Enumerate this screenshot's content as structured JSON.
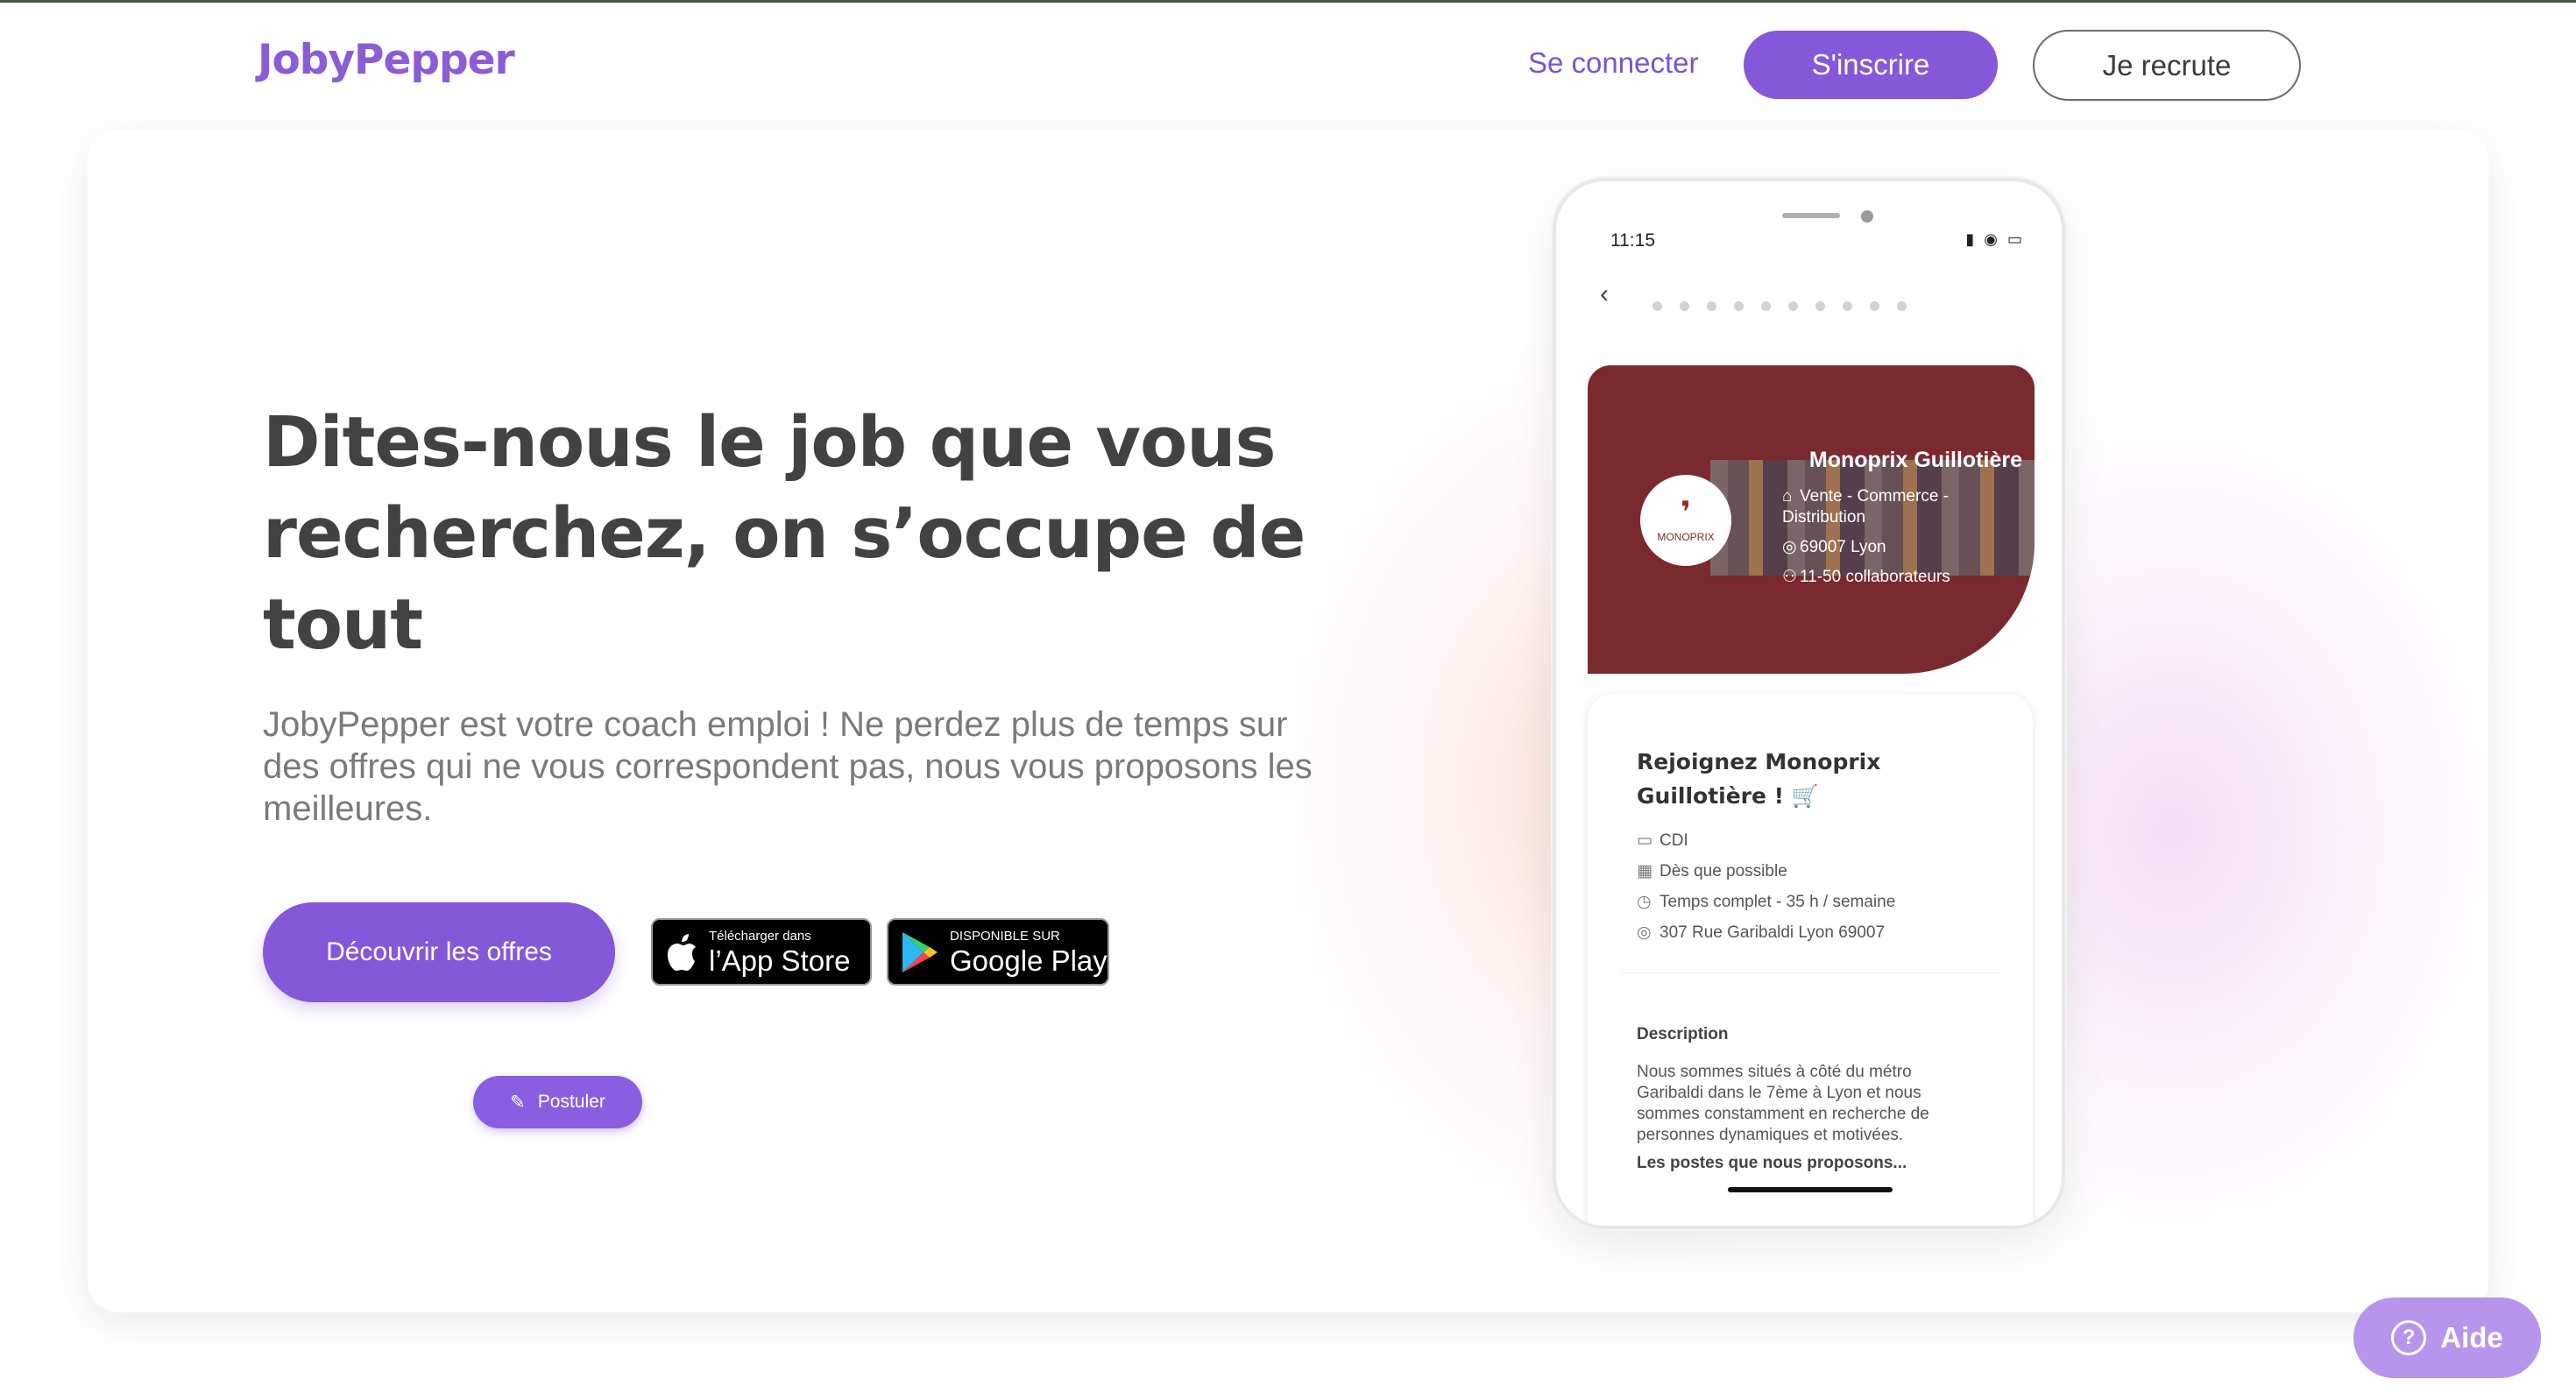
{
  "header": {
    "logo": "JobyPepper",
    "login_label": "Se connecter",
    "signup_label": "S'inscrire",
    "recruit_label": "Je recrute"
  },
  "hero": {
    "headline": "Dites-nous  le job que vous recherchez, on s’occupe de tout",
    "subtitle": "JobyPepper est votre coach emploi ! Ne perdez plus de temps sur des offres qui ne vous correspondent pas, nous vous proposons les meilleures.",
    "cta_label": "Découvrir les offres",
    "app_store": {
      "small": "Télécharger dans",
      "big": "l’App Store"
    },
    "google_play": {
      "small": "DISPONIBLE SUR",
      "big": "Google Play"
    }
  },
  "phone": {
    "time": "11:15",
    "company": {
      "logo_text": "MONOPRIX",
      "name": "Monoprix Guillotière",
      "sector": "Vente - Commerce - Distribution",
      "location": "69007 Lyon",
      "size": "11-50 collaborateurs"
    },
    "job": {
      "title": "Rejoignez Monoprix Guillotière ! 🛒",
      "contract": "CDI",
      "start": "Dès que possible",
      "schedule": "Temps complet - 35 h / semaine",
      "address": "307 Rue Garibaldi Lyon 69007",
      "description_title": "Description",
      "description": "Nous sommes situés à côté du métro Garibaldi dans le 7ème à Lyon et nous sommes constamment en recherche de personnes dynamiques et motivées.",
      "postes_title": "Les postes que nous proposons...",
      "apply_label": "Postuler"
    }
  },
  "help": {
    "label": "Aide"
  },
  "colors": {
    "brand": "#8557d9",
    "company_card": "#7a2a2f"
  }
}
